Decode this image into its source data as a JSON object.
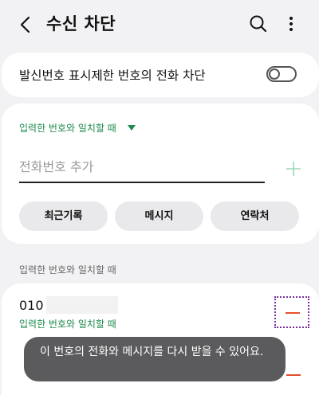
{
  "header": {
    "title": "수신 차단"
  },
  "settings": {
    "hide_number_block_label": "발신번호 표시제한 번호의 전화 차단",
    "hide_number_block_enabled": false
  },
  "add_number": {
    "condition_label": "입력한 번호와 일치할 때",
    "input_placeholder": "전화번호 추가",
    "buttons": {
      "recent": "최근기록",
      "messages": "메시지",
      "contacts": "연락처"
    }
  },
  "blocked_list": {
    "section_label": "입력한 번호와 일치할 때",
    "items": [
      {
        "number_prefix": "010",
        "condition": "입력한 번호와 일치할 때"
      }
    ]
  },
  "toast": {
    "message": "이 번호의 전화와 메시지를 다시 받을 수 있어요."
  },
  "colors": {
    "accent_green": "#1c8a4a",
    "remove_red": "#e2502c",
    "background": "#f2f2f4",
    "toast_bg": "#5b5b5d"
  }
}
